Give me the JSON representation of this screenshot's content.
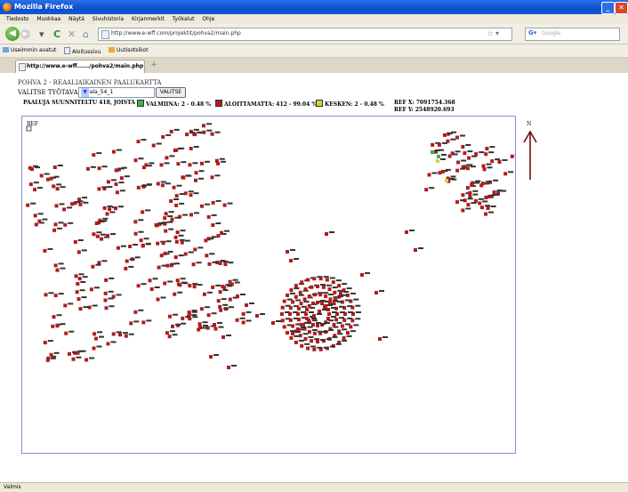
{
  "window": {
    "title": "Mozilla Firefox"
  },
  "menu": [
    "Tiedosto",
    "Muokkaa",
    "Näytä",
    "Sivuhistoria",
    "Kirjanmerkit",
    "Työkalut",
    "Ohje"
  ],
  "url": "http://www.e-wff.com/projektit/pohva2/main.php",
  "search_placeholder": "Google",
  "bookmarks": [
    "Useimmin avatut",
    "Aloitussivu",
    "Uutisotsikot"
  ],
  "tab": {
    "label": "http://www.e-wff....../pohva2/main.php",
    "new_tab": "+"
  },
  "page": {
    "title": "POHVA 2 - REAALIAIKAINEN PAALUKARTTA",
    "select_label": "VALITSE TYÖTAVA:",
    "select_value": "Nivala_54_1",
    "select_button": "VALITSE",
    "legend_main": "PAALUJA SUUNNITELTU 418, JOISTA",
    "legend_items": [
      {
        "label": "VALMIINA: 2 - 0.48 %",
        "color": "#3cb34a"
      },
      {
        "label": "ALOITTAMATTA: 412 - 99.04 %",
        "color": "#b01c1c"
      },
      {
        "label": "KESKEN: 2 - 0.48 %",
        "color": "#d8d035"
      }
    ],
    "ref_x": "REF X: 7091754.368",
    "ref_y": "REF Y: 2548920.693",
    "map_ref": "REF",
    "north": "N"
  },
  "status": "Valmis",
  "colors": {
    "pile": "#b01c1c",
    "done": "#3cb34a",
    "inprogress": "#d8d035"
  }
}
